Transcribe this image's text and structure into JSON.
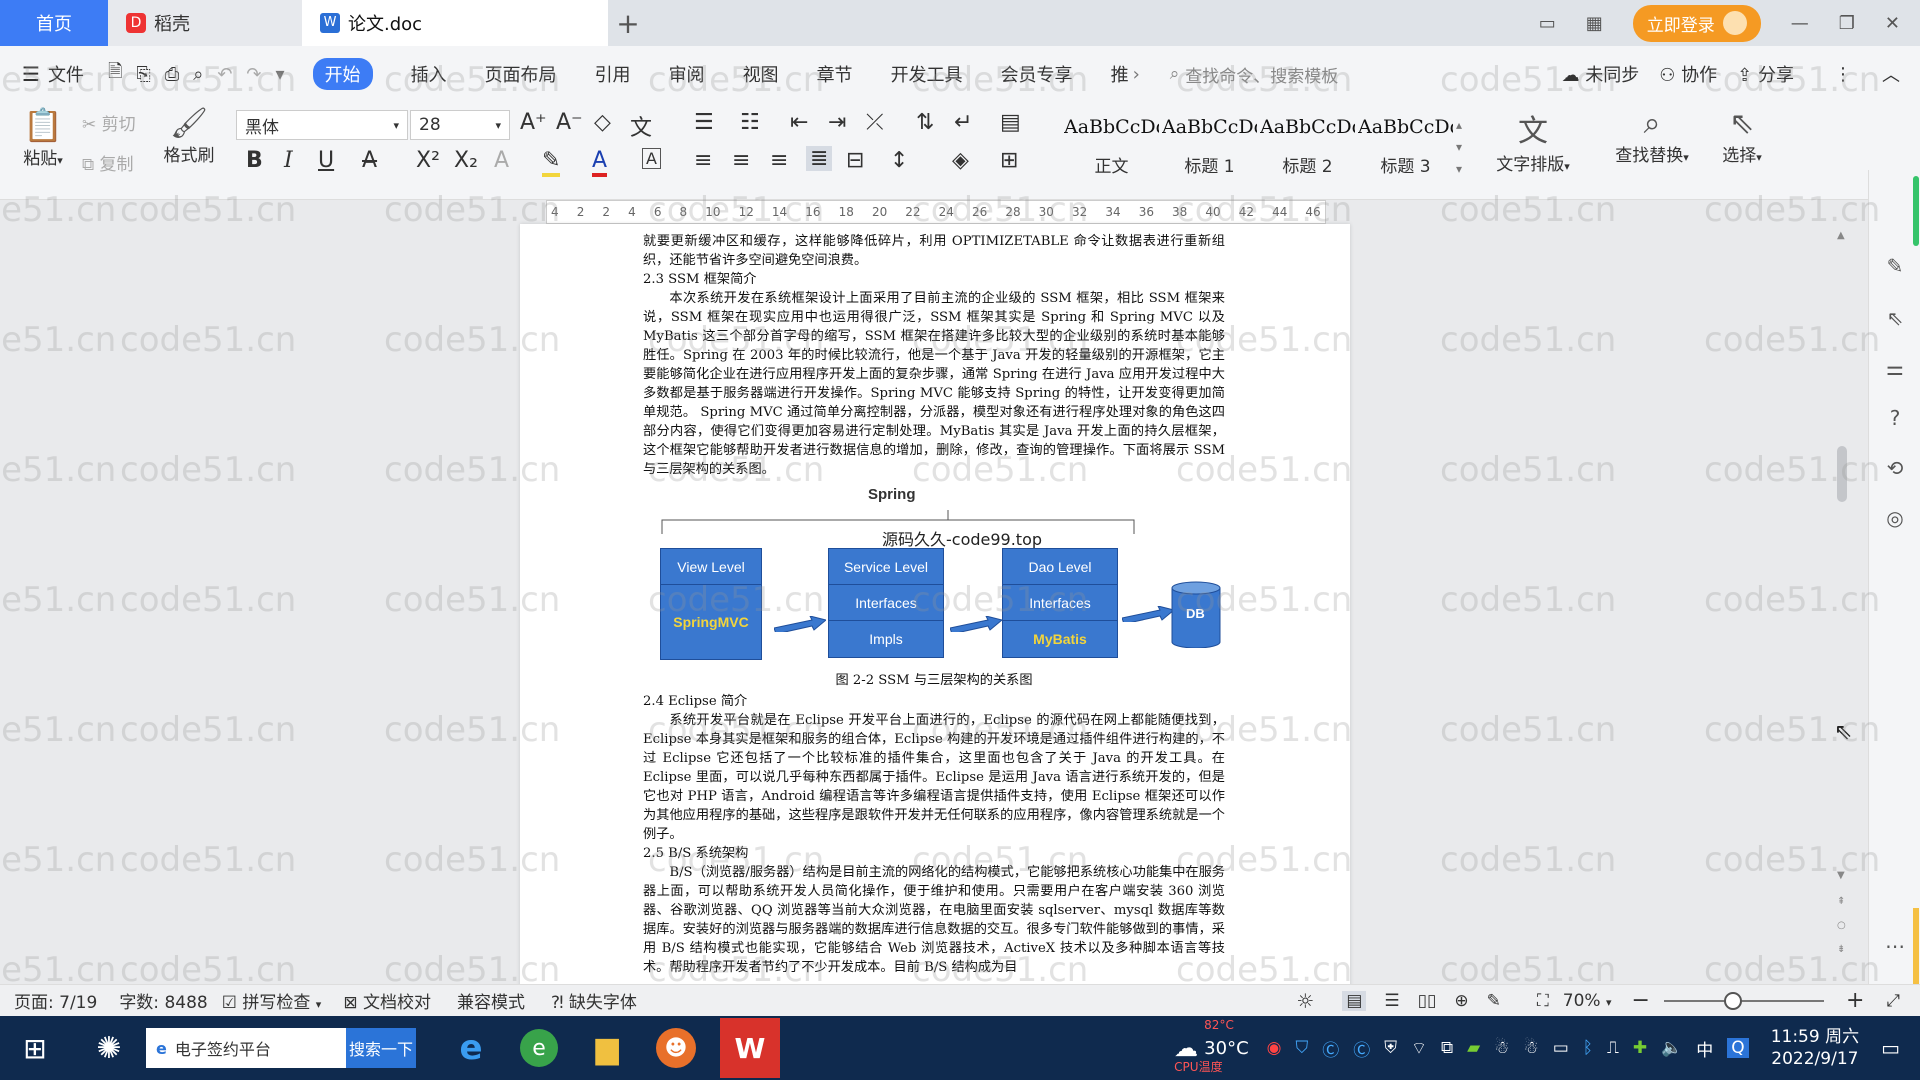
{
  "titlebar": {
    "tabs": [
      {
        "label": "首页"
      },
      {
        "label": "稻壳"
      },
      {
        "label": "论文.doc"
      }
    ],
    "new_tab": "+",
    "login": "立即登录"
  },
  "menubar": {
    "file": "文件",
    "items": [
      "开始",
      "插入",
      "页面布局",
      "引用",
      "审阅",
      "视图",
      "章节",
      "开发工具",
      "会员专享",
      "推"
    ],
    "search_cmd": "查找命令、搜索模板",
    "right": [
      "未同步",
      "协作",
      "分享"
    ]
  },
  "ribbon": {
    "paste": "粘贴",
    "cut": "剪切",
    "copy": "复制",
    "format_painter": "格式刷",
    "font_name": "黑体",
    "font_size": "28",
    "styles": [
      {
        "preview": "AaBbCcDd",
        "name": "正文"
      },
      {
        "preview": "AaBbCcDd",
        "name": "标题 1"
      },
      {
        "preview": "AaBbCcDd",
        "name": "标题 2"
      },
      {
        "preview": "AaBbCcDd",
        "name": "标题 3"
      }
    ],
    "text_layout": "文字排版",
    "find_replace": "查找替换",
    "select": "选择"
  },
  "ruler": {
    "ticks": [
      "4",
      "2",
      "2",
      "4",
      "6",
      "8",
      "10",
      "12",
      "14",
      "16",
      "18",
      "20",
      "22",
      "24",
      "26",
      "28",
      "30",
      "32",
      "34",
      "36",
      "38",
      "40",
      "42",
      "44",
      "46"
    ]
  },
  "document": {
    "para0": "就要更新缓冲区和缓存，这样能够降低碎片，利用 OPTIMIZETABLE 命令让数据表进行重新组织，还能节省许多空间避免空间浪费。",
    "h23": "2.3 SSM 框架简介",
    "para23": "本次系统开发在系统框架设计上面采用了目前主流的企业级的 SSM 框架，相比 SSM 框架来说，SSM 框架在现实应用中也运用得很广泛，SSM 框架其实是 Spring 和 Spring MVC 以及 MyBatis 这三个部分首字母的缩写，SSM 框架在搭建许多比较大型的企业级别的系统时基本能够胜任。Spring 在 2003 年的时候比较流行，他是一个基于 Java 开发的轻量级别的开源框架，它主要能够简化企业在进行应用程序开发上面的复杂步骤，通常 Spring 在进行 Java 应用开发过程中大多数都是基于服务器端进行开发操作。Spring MVC 能够支持 Spring 的特性，让开发变得更加简单规范。 Spring MVC 通过简单分离控制器，分派器，模型对象还有进行程序处理对象的角色这四部分内容，使得它们变得更加容易进行定制处理。MyBatis 其实是 Java 开发上面的持久层框架，这个框架它能够帮助开发者进行数据信息的增加，删除，修改，查询的管理操作。下面将展示 SSM 与三层架构的关系图。",
    "figure": {
      "spring": "Spring",
      "watermark_text": "源码久久-code99.top",
      "view_level": "View Level",
      "springmvc": "SpringMVC",
      "service_level": "Service Level",
      "interfaces1": "Interfaces",
      "impls": "Impls",
      "dao_level": "Dao Level",
      "interfaces2": "Interfaces",
      "mybatis": "MyBatis",
      "db": "DB",
      "caption": "图 2-2 SSM 与三层架构的关系图"
    },
    "h24": "2.4 Eclipse 简介",
    "para24": "系统开发平台就是在 Eclipse 开发平台上面进行的，Eclipse 的源代码在网上都能随便找到，Eclipse 本身其实是框架和服务的组合体，Eclipse 构建的开发环境是通过插件组件进行构建的，不过 Eclipse 它还包括了一个比较标准的插件集合，这里面也包含了关于 Java 的开发工具。在 Eclipse 里面，可以说几乎每种东西都属于插件。Eclipse 是运用 Java 语言进行系统开发的，但是它也对 PHP 语言，Android 编程语言等许多编程语言提供插件支持，使用 Eclipse 框架还可以作为其他应用程序的基础，这些程序是跟软件开发并无任何联系的应用程序，像内容管理系统就是一个例子。",
    "h25": "2.5 B/S 系统架构",
    "para25": "B/S（浏览器/服务器）结构是目前主流的网络化的结构模式，它能够把系统核心功能集中在服务器上面，可以帮助系统开发人员简化操作，便于维护和使用。只需要用户在客户端安装 360 浏览器、谷歌浏览器、QQ 浏览器等当前大众浏览器，在电脑里面安装 sqlserver、mysql 数据库等数据库。安装好的浏览器与服务器端的数据库进行信息数据的交互。很多专门软件能够做到的事情，采用 B/S 结构模式也能实现，它能够结合 Web 浏览器技术，ActiveX 技术以及多种脚本语言等技术。帮助程序开发者节约了不少开发成本。目前 B/S 结构成为目"
  },
  "statusbar": {
    "page": "页面: 7/19",
    "words": "字数: 8488",
    "spell": "拼写检查",
    "doc_check": "文档校对",
    "compat": "兼容模式",
    "missing_font": "缺失字体",
    "zoom": "70%"
  },
  "taskbar": {
    "search_text": "电子签约平台",
    "search_btn": "搜索一下",
    "weather_temp": "30°C",
    "weather_label": "CPU温度",
    "cpu_temp": "82°C",
    "ime": "中",
    "time": "11:59 周六",
    "date": "2022/9/17"
  },
  "watermark": "code51.cn"
}
